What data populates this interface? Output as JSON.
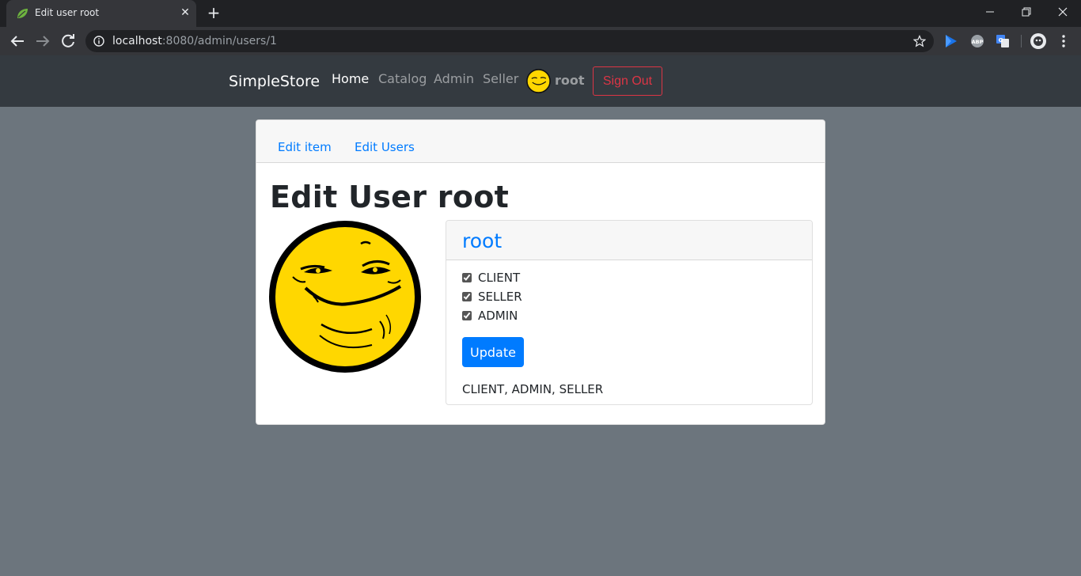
{
  "browser": {
    "tab_title": "Edit user root",
    "url_host": "localhost",
    "url_path": ":8080/admin/users/1"
  },
  "navbar": {
    "brand": "SimpleStore",
    "links": [
      {
        "label": "Home",
        "active": true
      },
      {
        "label": "Catalog",
        "active": false
      },
      {
        "label": "Admin",
        "active": false
      },
      {
        "label": "Seller",
        "active": false
      }
    ],
    "username": "root",
    "signout_label": "Sign Out"
  },
  "card": {
    "tabs": [
      {
        "label": "Edit item"
      },
      {
        "label": "Edit Users"
      }
    ],
    "title": "Edit User root",
    "user": {
      "name": "root",
      "roles": [
        {
          "label": "CLIENT",
          "checked": true
        },
        {
          "label": "SELLER",
          "checked": true
        },
        {
          "label": "ADMIN",
          "checked": true
        }
      ],
      "update_label": "Update",
      "roles_summary": "CLIENT, ADMIN, SELLER"
    }
  },
  "colors": {
    "page_bg": "#6c757d",
    "navbar_bg": "#343a40",
    "primary": "#007bff",
    "danger": "#dc3545",
    "avatar_yellow": "#ffd700"
  }
}
